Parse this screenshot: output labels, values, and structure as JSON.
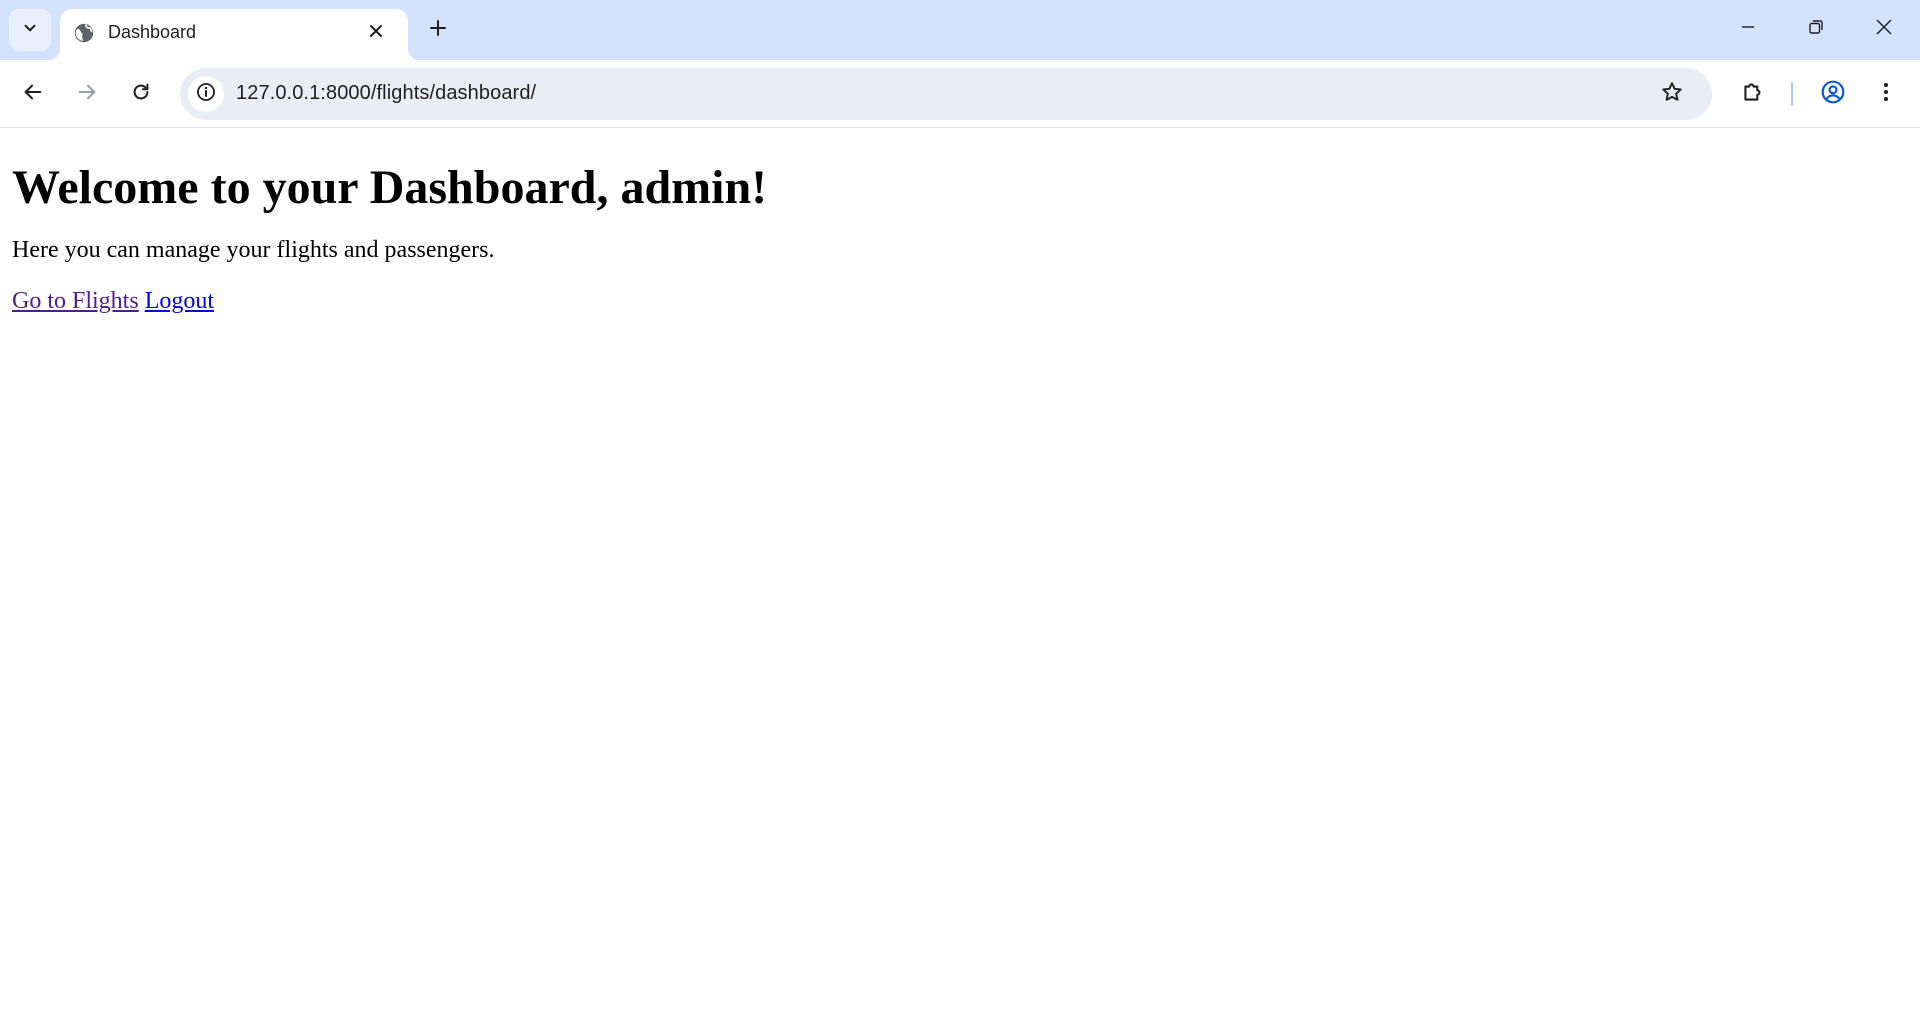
{
  "browser": {
    "tab": {
      "title": "Dashboard",
      "favicon": "globe-icon"
    },
    "address_bar": {
      "url": "127.0.0.1:8000/flights/dashboard/"
    },
    "icons": {
      "tab_search": "chevron-down-icon",
      "tab_close": "close-icon",
      "new_tab": "plus-icon",
      "minimize": "minimize-icon",
      "restore": "restore-icon",
      "close_window": "close-icon",
      "back": "arrow-left-icon",
      "forward": "arrow-right-icon",
      "reload": "reload-icon",
      "site_info": "info-icon",
      "bookmark": "star-icon",
      "extensions": "puzzle-icon",
      "profile": "account-icon",
      "menu": "kebab-menu-icon"
    },
    "colors": {
      "tabstrip_bg": "#d3e3fd",
      "omnibox_bg": "#e9eef6",
      "profile_accent": "#0b57d0"
    }
  },
  "page": {
    "heading": "Welcome to your Dashboard, admin!",
    "description": "Here you can manage your flights and passengers.",
    "links": [
      {
        "label": "Go to Flights",
        "state": "visited",
        "color": "#551a8b"
      },
      {
        "label": "Logout",
        "state": "unvisited",
        "color": "#0000ee"
      }
    ]
  }
}
